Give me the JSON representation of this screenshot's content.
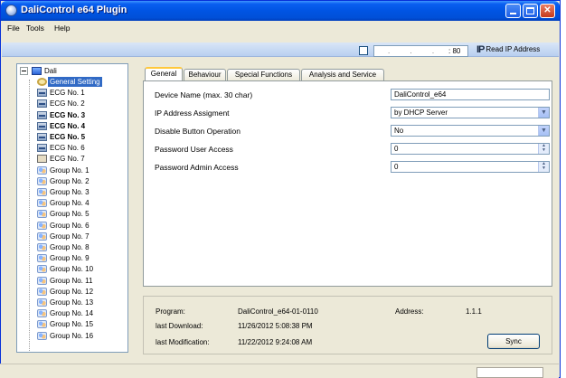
{
  "window": {
    "title": "DaliControl e64 Plugin"
  },
  "menu": [
    {
      "label": "File"
    },
    {
      "label": "Tools"
    },
    {
      "label": "Help"
    }
  ],
  "connection": {
    "ip_value": ". . .",
    "port": ": 80",
    "read_ip_icon": "IP",
    "read_ip_label": "Read IP Address"
  },
  "tree": {
    "root": "Dali",
    "items": [
      {
        "label": "General Setting",
        "icon": "gear-icon"
      },
      {
        "label": "ECG No. 1",
        "icon": "ecg-icon"
      },
      {
        "label": "ECG No. 2",
        "icon": "ecg-icon"
      },
      {
        "label": "ECG No. 3",
        "icon": "ecg-icon"
      },
      {
        "label": "ECG No. 4",
        "icon": "ecg-icon"
      },
      {
        "label": "ECG No. 5",
        "icon": "ecg-icon"
      },
      {
        "label": "ECG No. 6",
        "icon": "ecg-icon"
      },
      {
        "label": "ECG No. 7",
        "icon": "house-icon"
      },
      {
        "label": "Group No. 1",
        "icon": "group-icon"
      },
      {
        "label": "Group No. 2",
        "icon": "group-icon"
      },
      {
        "label": "Group No. 3",
        "icon": "group-icon"
      },
      {
        "label": "Group No. 4",
        "icon": "group-icon"
      },
      {
        "label": "Group No. 5",
        "icon": "group-icon"
      },
      {
        "label": "Group No. 6",
        "icon": "group-icon"
      },
      {
        "label": "Group No. 7",
        "icon": "group-icon"
      },
      {
        "label": "Group No. 8",
        "icon": "group-icon"
      },
      {
        "label": "Group No. 9",
        "icon": "group-icon"
      },
      {
        "label": "Group No. 10",
        "icon": "group-icon"
      },
      {
        "label": "Group No. 11",
        "icon": "group-icon"
      },
      {
        "label": "Group No. 12",
        "icon": "group-icon"
      },
      {
        "label": "Group No. 13",
        "icon": "group-icon"
      },
      {
        "label": "Group No. 14",
        "icon": "group-icon"
      },
      {
        "label": "Group No. 15",
        "icon": "group-icon"
      },
      {
        "label": "Group No. 16",
        "icon": "group-icon"
      }
    ]
  },
  "tabs": [
    {
      "label": "General"
    },
    {
      "label": "Behaviour"
    },
    {
      "label": "Special Functions"
    },
    {
      "label": "Analysis and Service"
    }
  ],
  "general": {
    "device_name_label": "Device Name (max. 30 char)",
    "device_name_value": "DaliControl_e64",
    "ip_assign_label": "IP Address Assigment",
    "ip_assign_value": "by DHCP Server",
    "disable_button_label": "Disable Button Operation",
    "disable_button_value": "No",
    "pw_user_label": "Password User Access",
    "pw_user_value": "0",
    "pw_admin_label": "Password Admin Access",
    "pw_admin_value": "0"
  },
  "info": {
    "program_label": "Program:",
    "program_value": "DaliControl_e64-01-0110",
    "address_label": "Address:",
    "address_value": "1.1.1",
    "last_download_label": "last Download:",
    "last_download_value": "11/26/2012 5:08:38 PM",
    "last_mod_label": "last Modification:",
    "last_mod_value": "11/22/2012 9:24:08 AM",
    "sync_label": "Sync"
  }
}
